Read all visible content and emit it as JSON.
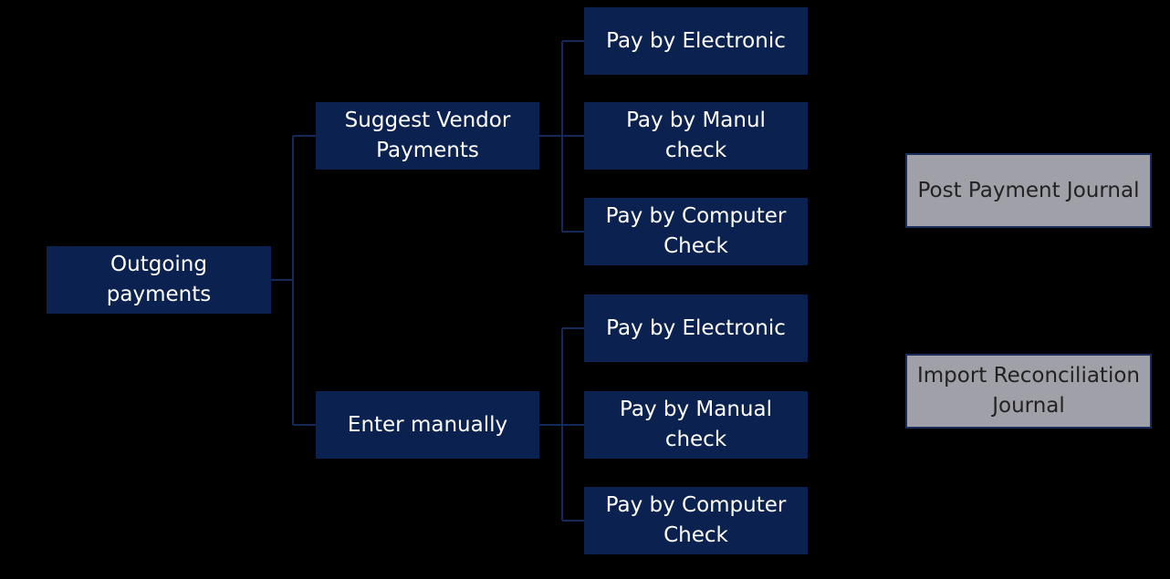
{
  "diagram": {
    "root": {
      "label": "Outgoing\npayments"
    },
    "branches": [
      {
        "label": "Suggest Vendor\nPayments",
        "children": [
          "Pay by Electronic",
          "Pay by Manul\ncheck",
          "Pay by Computer\nCheck"
        ]
      },
      {
        "label": "Enter manually",
        "children": [
          "Pay by Electronic",
          "Pay by  Manual\ncheck",
          "Pay by Computer\nCheck"
        ]
      }
    ],
    "side_boxes": [
      "Post Payment Journal",
      "Import Reconciliation\nJournal"
    ],
    "colors": {
      "node_fill": "#0b2150",
      "connector": "#132a5a",
      "side_fill": "#a0a0a8",
      "background": "#000000"
    }
  }
}
